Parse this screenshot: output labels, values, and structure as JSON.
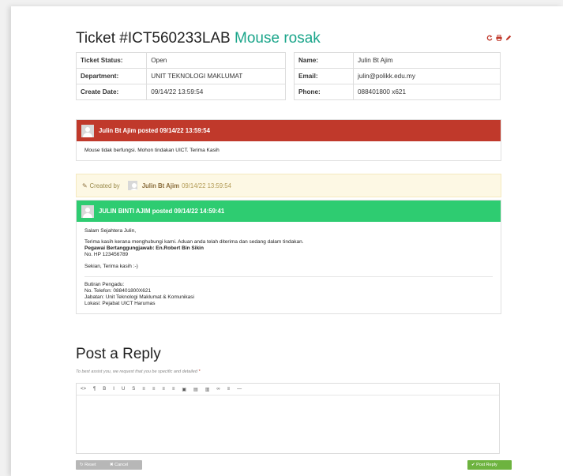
{
  "ticket": {
    "number_label": "Ticket #ICT560233LAB",
    "subject": "Mouse rosak",
    "icons": [
      "refresh-icon",
      "print-icon",
      "edit-icon"
    ]
  },
  "info_left": [
    {
      "label": "Ticket Status:",
      "value": "Open"
    },
    {
      "label": "Department:",
      "value": "UNIT TEKNOLOGI MAKLUMAT"
    },
    {
      "label": "Create Date:",
      "value": "09/14/22 13:59:54"
    }
  ],
  "info_right": [
    {
      "label": "Name:",
      "value": "Julin Bt Ajim"
    },
    {
      "label": "Email:",
      "value": "julin@polikk.edu.my"
    },
    {
      "label": "Phone:",
      "value": "088401800 x621"
    }
  ],
  "thread1": {
    "header": "Julin Bt Ajim posted 09/14/22 13:59:54",
    "body": "Mouse tidak berfungsi. Mohon tindakan UICT. Terima Kasih"
  },
  "event": {
    "created_by": "Created by",
    "name": "Julin Bt Ajim",
    "time": "09/14/22 13:59:54"
  },
  "thread2": {
    "header": "JULIN BINTI AJIM posted 09/14/22 14:59:41",
    "greeting": "Salam Sejahtera Julin,",
    "line1": "Terima kasih kerana menghubungi kami. Aduan anda telah diterima dan sedang dalam tindakan.",
    "officer": "Pegawai Bertanggungjawab: En.Robert Bin Sikin",
    "phone": "No. HP 123456789",
    "closing": "Sekian, Terima kasih :-)",
    "sig1": "Butiran Pengadu:",
    "sig2": "No. Telefon: 088401800X621",
    "sig3": "Jabatan: Unit Teknologi Maklumat & Komunikasi",
    "sig4": "Lokasi: Pejabat UICT Harumas"
  },
  "reply": {
    "title": "Post a Reply",
    "hint": "To best assist you, we request that you be specific and detailed",
    "required_mark": "*",
    "toolbar": [
      "<>",
      "¶",
      "B",
      "I",
      "U",
      "S",
      "≡",
      "≡",
      "≡",
      "≡",
      "▣",
      "▤",
      "▥",
      "∞",
      "≡",
      "—"
    ],
    "reset_label": "Reset",
    "cancel_label": "Cancel",
    "post_label": "Post Reply"
  },
  "colors": {
    "accent": "#1aa58a",
    "thread_red": "#c0392b",
    "thread_green": "#2ecc71",
    "post_button": "#6db33f"
  }
}
